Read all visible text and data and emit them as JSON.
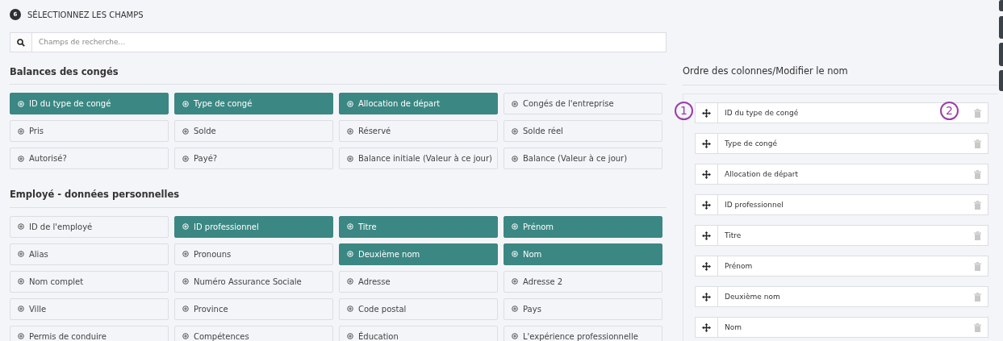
{
  "step": {
    "number": "6",
    "title": "SÉLECTIONNEZ LES CHAMPS"
  },
  "search": {
    "placeholder": "Champs de recherche..."
  },
  "sections": [
    {
      "title": "Balances des congés",
      "items": [
        {
          "label": "ID du type de congé",
          "selected": true
        },
        {
          "label": "Type de congé",
          "selected": true
        },
        {
          "label": "Allocation de départ",
          "selected": true
        },
        {
          "label": "Congés de l'entreprise",
          "selected": false
        },
        {
          "label": "Pris",
          "selected": false
        },
        {
          "label": "Solde",
          "selected": false
        },
        {
          "label": "Réservé",
          "selected": false
        },
        {
          "label": "Solde réel",
          "selected": false
        },
        {
          "label": "Autorisé?",
          "selected": false
        },
        {
          "label": "Payé?",
          "selected": false
        },
        {
          "label": "Balance initiale (Valeur à ce jour)",
          "selected": false
        },
        {
          "label": "Balance (Valeur à ce jour)",
          "selected": false
        }
      ]
    },
    {
      "title": "Employé - données personnelles",
      "items": [
        {
          "label": "ID de l'employé",
          "selected": false
        },
        {
          "label": "ID professionnel",
          "selected": true
        },
        {
          "label": "Titre",
          "selected": true
        },
        {
          "label": "Prénom",
          "selected": true
        },
        {
          "label": "Alias",
          "selected": false
        },
        {
          "label": "Pronouns",
          "selected": false
        },
        {
          "label": "Deuxième nom",
          "selected": true
        },
        {
          "label": "Nom",
          "selected": true
        },
        {
          "label": "Nom complet",
          "selected": false
        },
        {
          "label": "Numéro Assurance Sociale",
          "selected": false
        },
        {
          "label": "Adresse",
          "selected": false
        },
        {
          "label": "Adresse 2",
          "selected": false
        },
        {
          "label": "Ville",
          "selected": false
        },
        {
          "label": "Province",
          "selected": false
        },
        {
          "label": "Code postal",
          "selected": false
        },
        {
          "label": "Pays",
          "selected": false
        },
        {
          "label": "Permis de conduire",
          "selected": false
        },
        {
          "label": "Compétences",
          "selected": false
        },
        {
          "label": "Éducation",
          "selected": false
        },
        {
          "label": "L'expérience professionnelle",
          "selected": false
        }
      ]
    }
  ],
  "column_order": {
    "title": "Ordre des colonnes/Modifier le nom",
    "columns": [
      {
        "name": "ID du type de congé"
      },
      {
        "name": "Type de congé"
      },
      {
        "name": "Allocation de départ"
      },
      {
        "name": "ID professionnel"
      },
      {
        "name": "Titre"
      },
      {
        "name": "Prénom"
      },
      {
        "name": "Deuxième nom"
      },
      {
        "name": "Nom"
      }
    ]
  },
  "callouts": [
    "1",
    "2"
  ]
}
